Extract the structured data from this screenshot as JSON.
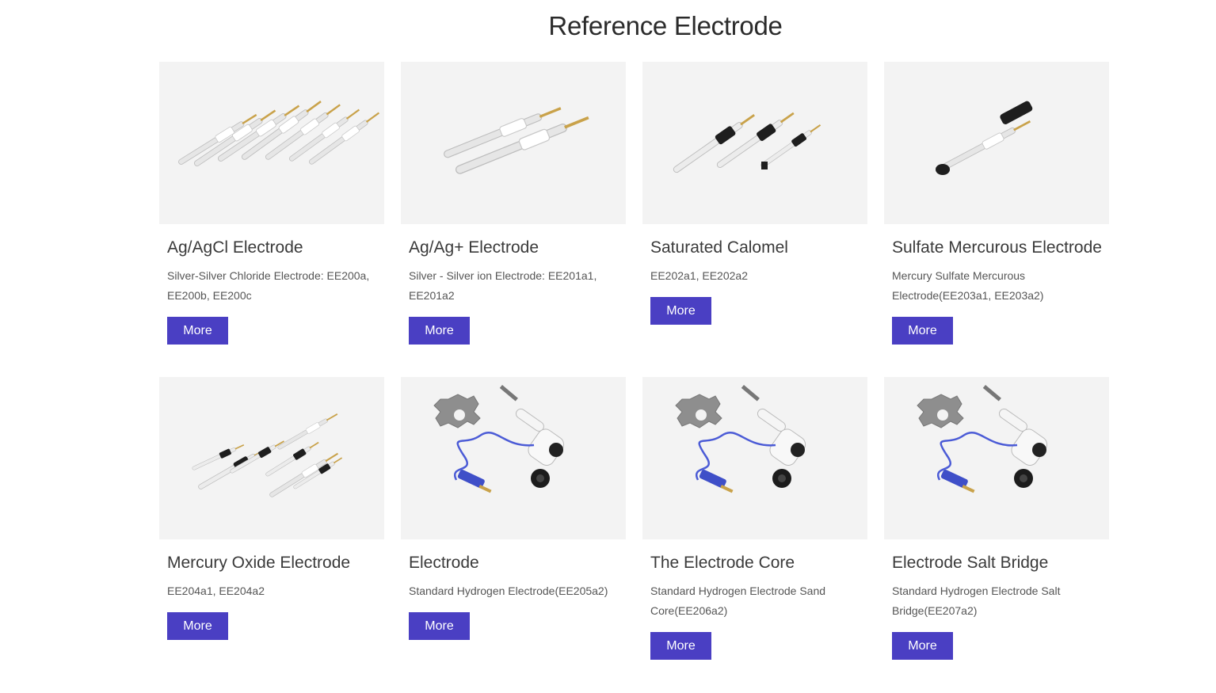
{
  "page": {
    "title": "Reference Electrode",
    "accent_color": "#4a3fc3"
  },
  "products": [
    {
      "title": "Ag/AgCl Electrode",
      "description": "Silver-Silver Chloride Electrode: EE200a, EE200b, EE200c",
      "button": "More",
      "image_icon": "electrode-set-icon"
    },
    {
      "title": "Ag/Ag+ Electrode",
      "description": "Silver - Silver ion Electrode: EE201a1, EE201a2",
      "button": "More",
      "image_icon": "electrode-pair-icon"
    },
    {
      "title": "Saturated Calomel",
      "description": "EE202a1, EE202a2",
      "button": "More",
      "image_icon": "calomel-electrode-icon"
    },
    {
      "title": "Sulfate Mercurous Electrode",
      "description": "Mercury Sulfate Mercurous Electrode(EE203a1, EE203a2)",
      "button": "More",
      "image_icon": "sulfate-electrode-icon"
    },
    {
      "title": "Mercury Oxide Electrode",
      "description": "EE204a1, EE204a2",
      "button": "More",
      "image_icon": "mercury-oxide-electrode-icon"
    },
    {
      "title": "Electrode",
      "description": "Standard Hydrogen Electrode(EE205a2)",
      "button": "More",
      "image_icon": "hydrogen-electrode-icon"
    },
    {
      "title": "The Electrode Core",
      "description": "Standard Hydrogen Electrode Sand Core(EE206a2)",
      "button": "More",
      "image_icon": "hydrogen-electrode-icon"
    },
    {
      "title": "Electrode Salt Bridge",
      "description": "Standard Hydrogen Electrode Salt Bridge(EE207a2)",
      "button": "More",
      "image_icon": "hydrogen-electrode-icon"
    }
  ]
}
